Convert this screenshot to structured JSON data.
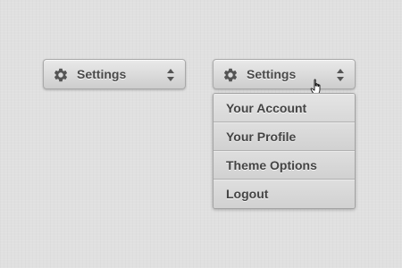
{
  "dropdown_closed": {
    "label": "Settings",
    "icon": "gear-icon",
    "indicator_icon": "updown-arrows-icon"
  },
  "dropdown_open": {
    "label": "Settings",
    "icon": "gear-icon",
    "indicator_icon": "updown-arrows-icon",
    "cursor_icon": "hand-pointer-cursor-icon",
    "items": [
      {
        "label": "Your Account"
      },
      {
        "label": "Your Profile"
      },
      {
        "label": "Theme Options"
      },
      {
        "label": "Logout"
      }
    ]
  },
  "colors": {
    "background": "#e0e0e0",
    "text": "#4a4a4a",
    "icon": "#555555"
  }
}
